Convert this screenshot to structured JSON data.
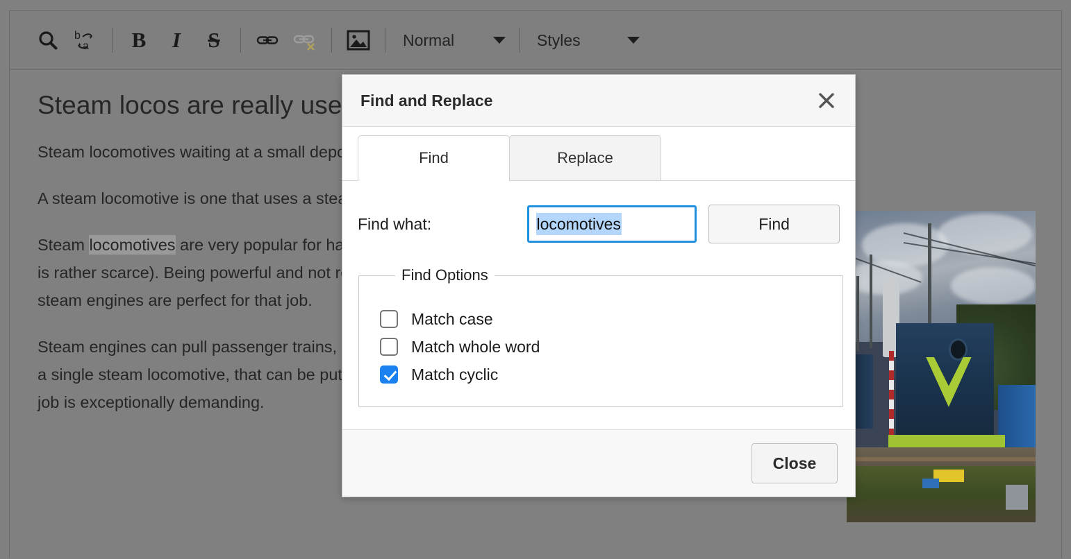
{
  "toolbar": {
    "items": [
      {
        "name": "search-icon",
        "label": "Search",
        "type": "icon"
      },
      {
        "name": "find-replace-icon",
        "label": "Find and Replace",
        "type": "icon"
      },
      {
        "name": "bold-icon",
        "label": "B",
        "type": "text"
      },
      {
        "name": "italic-icon",
        "label": "I",
        "type": "text"
      },
      {
        "name": "strikethrough-icon",
        "label": "S",
        "type": "text"
      },
      {
        "name": "insert-link-icon",
        "label": "Insert link",
        "type": "icon"
      },
      {
        "name": "remove-link-icon",
        "label": "Remove link",
        "type": "icon"
      },
      {
        "name": "insert-image-icon",
        "label": "Insert image",
        "type": "icon"
      }
    ],
    "paragraph_style": "Normal",
    "styles_dropdown": "Styles"
  },
  "document": {
    "title": "Steam locos are really useful",
    "paragraphs": [
      {
        "id": "p1",
        "runs": [
          {
            "text": "Steam locomotives waiting at a small depot on a sunny day.",
            "highlight": false
          }
        ]
      },
      {
        "id": "p2",
        "runs": [
          {
            "text": "A steam locomotive is one that uses a steam engine as a source of power to move and pull the cars.",
            "highlight": false
          }
        ]
      },
      {
        "id": "p3",
        "runs": [
          {
            "text": "Steam ",
            "highlight": false
          },
          {
            "text": "locomotives",
            "highlight": true
          },
          {
            "text": " are very popular for hauling heavy freight on all continents (with the exception of Antarctica where the rail network is rather scarce). Being powerful and not requiring much technical infrastructure like their younger diesel and electric locomotives — steam engines are perfect for that job.",
            "highlight": false
          }
        ]
      },
      {
        "id": "p4",
        "runs": [
          {
            "text": "Steam engines can pull passenger trains, tank cars, hoppers and platform wagons with wood logs... Should the load be too heavy for a single steam locomotive, that can be put together in a pair of engines. And sometimes you can even see three of four of them if the job is exceptionally demanding.",
            "highlight": false
          }
        ]
      }
    ],
    "photo_alt": "Blue and green diesel shunting locomotive standing in a railway yard with signal mast, overhead wires and tracks"
  },
  "dialog": {
    "title": "Find and Replace",
    "close_icon": "close-icon",
    "tabs": [
      {
        "label": "Find",
        "active": true
      },
      {
        "label": "Replace",
        "active": false
      }
    ],
    "find_label": "Find what:",
    "find_value": "locomotives",
    "find_placeholder": "",
    "find_button": "Find",
    "options_legend": "Find Options",
    "options": [
      {
        "label": "Match case",
        "checked": false
      },
      {
        "label": "Match whole word",
        "checked": false
      },
      {
        "label": "Match cyclic",
        "checked": true
      }
    ],
    "close_button": "Close"
  },
  "colors": {
    "accent_blue": "#1a82f0",
    "focus_border": "#1e90e0",
    "selection_highlight": "#b5d6fb",
    "dialog_header_bg": "#f6f6f6",
    "overlay_gray": "#808080",
    "doc_text": "#262626"
  }
}
